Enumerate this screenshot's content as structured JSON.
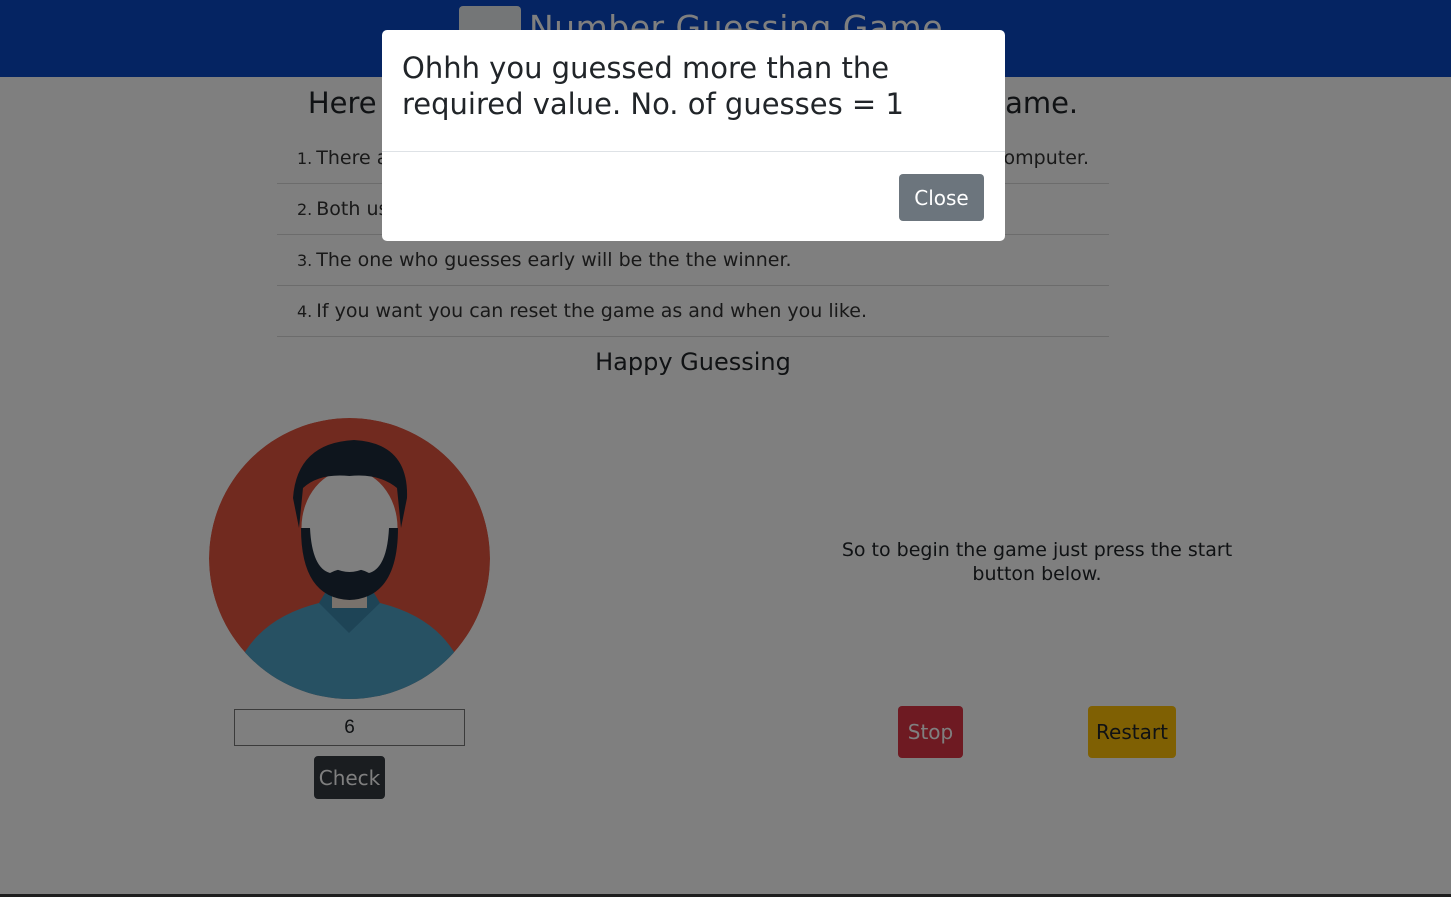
{
  "header": {
    "title": "Number Guessing Game",
    "logo_icon": "smiley-face-icon",
    "background": "#0a48c4"
  },
  "rules": {
    "heading_left": "Here",
    "heading_right": "ame.",
    "items": [
      {
        "num": "1.",
        "left": "There a",
        "right": "omputer."
      },
      {
        "num": "2.",
        "left": "Both us",
        "right": ""
      },
      {
        "num": "3.",
        "left": "The one who guesses early will be the the winner.",
        "right": ""
      },
      {
        "num": "4.",
        "left": "If you want you can reset the game as and when you like.",
        "right": ""
      }
    ]
  },
  "happy_guessing": "Happy Guessing",
  "player": {
    "avatar_icon": "bearded-man-avatar-icon",
    "guess_value": "6",
    "check_label": "Check"
  },
  "game": {
    "begin_text": "So to begin the game just press the start button below.",
    "stop_label": "Stop",
    "restart_label": "Restart"
  },
  "modal": {
    "message": "Ohhh you guessed more than the required value. No. of guesses = 1",
    "close_label": "Close"
  }
}
